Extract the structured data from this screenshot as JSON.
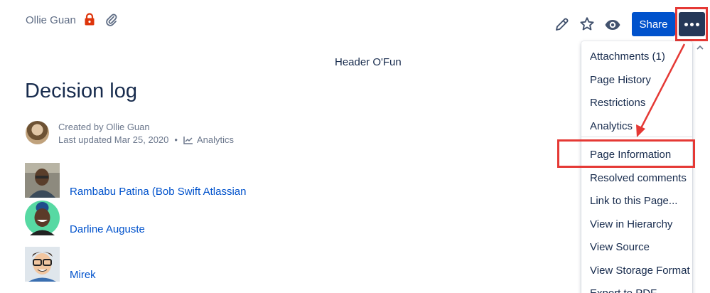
{
  "breadcrumb": {
    "author": "Ollie Guan"
  },
  "toolbar": {
    "share_label": "Share"
  },
  "page": {
    "header_text": "Header O'Fun",
    "title": "Decision log",
    "created_by": "Created by Ollie Guan",
    "last_updated": "Last updated Mar 25, 2020",
    "separator": "•",
    "analytics_label": "Analytics"
  },
  "people": [
    {
      "name": "Rambabu Patina (Bob Swift Atlassian"
    },
    {
      "name": "Darline Auguste"
    },
    {
      "name": "Mirek"
    }
  ],
  "menu": {
    "items": [
      "Attachments (1)",
      "Page History",
      "Restrictions",
      "Analytics",
      "Page Information",
      "Resolved comments",
      "Link to this Page...",
      "View in Hierarchy",
      "View Source",
      "View Storage Format",
      "Export to PDF"
    ]
  },
  "colors": {
    "accent": "#0052cc",
    "more_button": "#253858",
    "annotation": "#e53935",
    "lock": "#de350b"
  }
}
